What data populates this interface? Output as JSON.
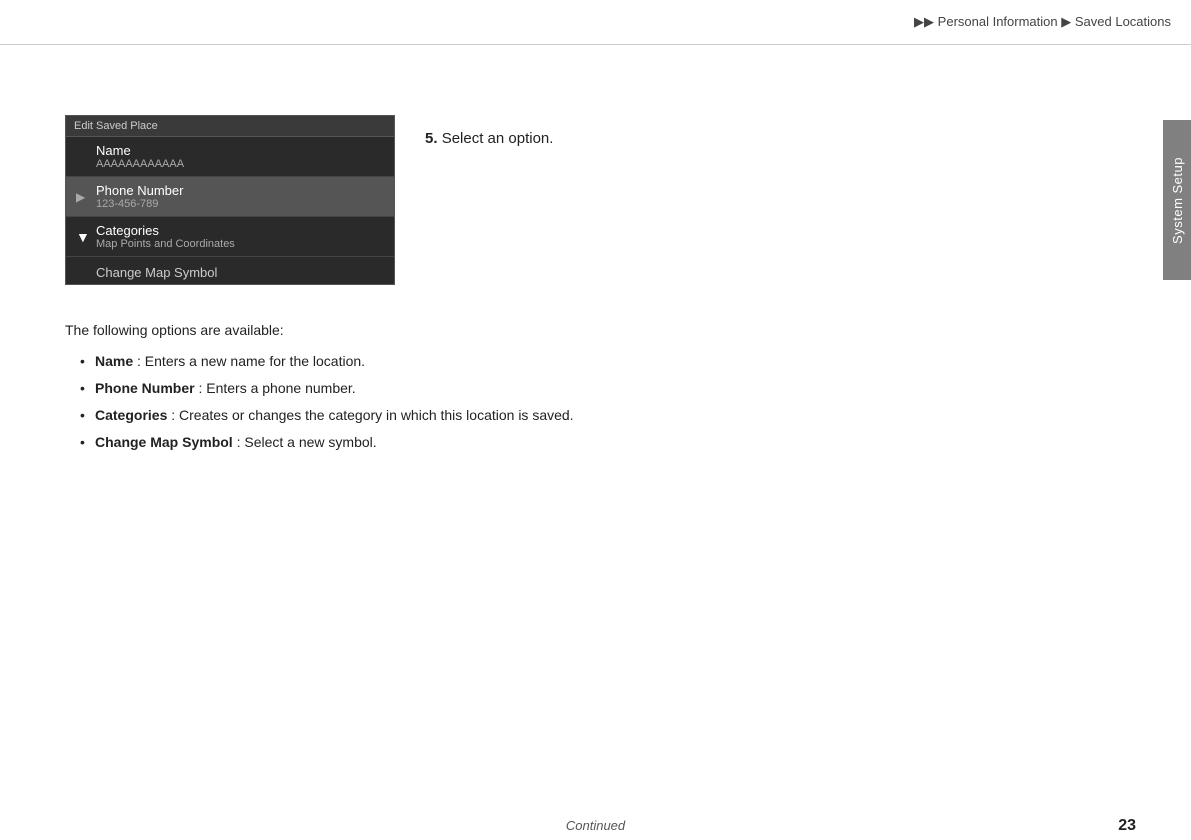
{
  "breadcrumb": {
    "arrows": "▶▶",
    "part1": "Personal Information",
    "arrow2": "▶",
    "part2": "Saved Locations"
  },
  "sidebar": {
    "label": "System Setup"
  },
  "device": {
    "title": "Edit Saved Place",
    "items": [
      {
        "id": "name-item",
        "title": "Name",
        "subtitle": "AAAAAAAAAAAA",
        "hasArrowRight": false,
        "hasArrowDown": false,
        "active": false
      },
      {
        "id": "phone-item",
        "title": "Phone Number",
        "subtitle": "123-456-789",
        "hasArrowRight": true,
        "hasArrowDown": false,
        "active": false
      },
      {
        "id": "categories-item",
        "title": "Categories",
        "subtitle": "Map Points and Coordinates",
        "hasArrowRight": false,
        "hasArrowDown": true,
        "active": false
      }
    ],
    "bottomItem": "Change Map Symbol"
  },
  "step": {
    "number": "5.",
    "text": "Select an option."
  },
  "description": {
    "intro": "The following options are available:",
    "bullets": [
      {
        "term": "Name",
        "description": ": Enters a new name for the location."
      },
      {
        "term": "Phone Number",
        "description": ": Enters a phone number."
      },
      {
        "term": "Categories",
        "description": ": Creates or changes the category in which this location is saved."
      },
      {
        "term": "Change Map Symbol",
        "description": ": Select a new symbol."
      }
    ]
  },
  "footer": {
    "continued": "Continued",
    "page_number": "23"
  }
}
